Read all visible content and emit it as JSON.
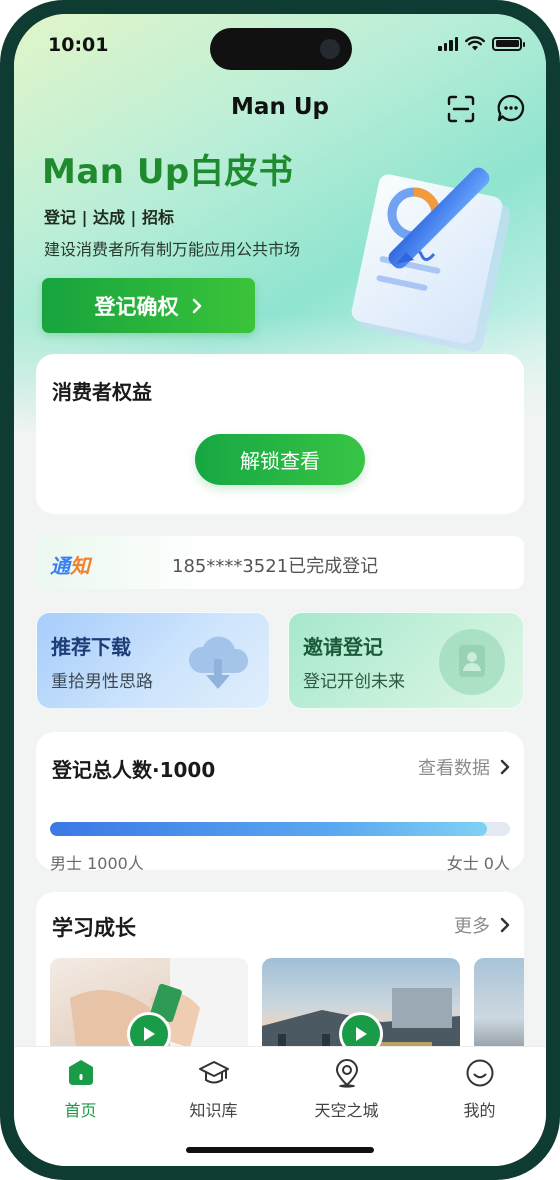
{
  "status_bar": {
    "time": "10:01"
  },
  "nav": {
    "title": "Man Up",
    "scan_icon": "scan-icon",
    "chat_icon": "chat-bubble-icon"
  },
  "hero": {
    "title": "Man Up白皮书",
    "tags": "登记 | 达成 | 招标",
    "subtitle": "建设消费者所有制万能应用公共市场",
    "register_button": "登记确权"
  },
  "rights_card": {
    "title": "消费者权益",
    "unlock_button": "解锁查看"
  },
  "notice": {
    "label_part1": "通",
    "label_part2": "知",
    "text": "185****3521已完成登记"
  },
  "promos": [
    {
      "title": "推荐下载",
      "subtitle": "重拾男性思路",
      "icon": "cloud-download-icon"
    },
    {
      "title": "邀请登记",
      "subtitle": "登记开创未来",
      "icon": "contact-card-icon"
    }
  ],
  "stats": {
    "title": "登记总人数·1000",
    "link": "查看数据",
    "male": "男士 1000人",
    "female": "女士 0人",
    "male_fraction": 0.95
  },
  "learning": {
    "title": "学习成长",
    "link": "更多"
  },
  "tabs": [
    {
      "label": "首页",
      "icon": "home-icon",
      "active": true
    },
    {
      "label": "知识库",
      "icon": "graduation-cap-icon",
      "active": false
    },
    {
      "label": "天空之城",
      "icon": "location-pin-icon",
      "active": false
    },
    {
      "label": "我的",
      "icon": "smiley-profile-icon",
      "active": false
    }
  ],
  "colors": {
    "brand_green": "#1a9b47",
    "hero_title_green": "#1f8a2e",
    "progress_blue": "#3c78e6",
    "notice_blue": "#3b7ff0",
    "notice_orange": "#f0812f"
  }
}
